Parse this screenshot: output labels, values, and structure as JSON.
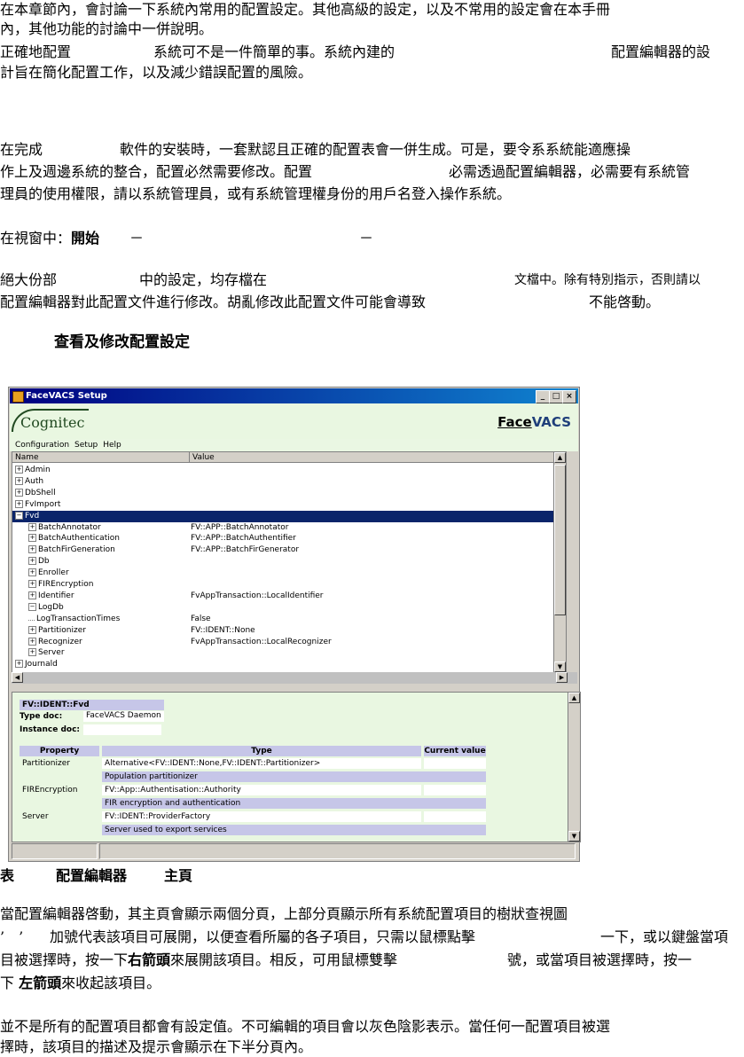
{
  "text": {
    "p1_l1": "在本章節內，會討論一下系統內常用的配置設定。其他高級的設定，以及不常用的設定會在本手冊",
    "p1_l2": "內，其他功能的討論中一併說明。",
    "p2_l1a": "正確地配置",
    "p2_l1b": "系統可不是一件簡單的事。系統內建的",
    "p2_l1c": "配置編輯器的設",
    "p2_l2": "計旨在簡化配置工作，以及減少錯誤配置的風險。",
    "p3_l1a": "在完成",
    "p3_l1b": "軟件的安裝時，一套默認且正確的配置表會一併生成。可是，要令系系統能適應操",
    "p3_l2a": "作上及週邊系統的整合，配置必然需要修改。配置",
    "p3_l2b": "必需透過配置編輯器，必需要有系統管",
    "p3_l3": "理員的使用權限，請以系統管理員，或有系統管理權身份的用戶名登入操作系統。",
    "p4_a": "在視窗中：",
    "p4_b": "開始",
    "p4_c": "－",
    "p4_d": "－",
    "p5_l1a": "絕大份部",
    "p5_l1b": "中的設定，均存檔在",
    "p5_l1c": "文檔中。除有特別指示，否則請以",
    "p5_l2a": "配置編輯器對此配置文件進行修改。胡亂修改此配置文件可能會導致",
    "p5_l2b": "不能啓動。",
    "heading": "查看及修改配置設定",
    "caption_a": "表",
    "caption_b": "配置編輯器",
    "caption_c": "主頁",
    "p6_l1": "當配置編輯器啓動，其主頁會顯示兩個分頁，上部分頁顯示所有系統配置項目的樹狀查視圖",
    "p6_l2a": "’　’",
    "p6_l2b": "加號代表該項目可展開，以便查看所屬的各子項目，只需以鼠標點擊",
    "p6_l2c": "一下，或以鍵盤當項",
    "p6_l3a": "目被選擇時，按一下",
    "p6_l3b": "右箭頭",
    "p6_l3c": "來展開該項目。相反，可用鼠標雙擊",
    "p6_l3d": "號，或當項目被選擇時，按一",
    "p6_l4a": "下",
    "p6_l4b": "左箭頭",
    "p6_l4c": "來收起該項目。",
    "p7_l1": "並不是所有的配置項目都會有設定值。不可編輯的項目會以灰色陰影表示。當任何一配置項目被選",
    "p7_l2": "擇時，該項目的描述及提示會顯示在下半分頁內。"
  },
  "window": {
    "title": "FaceVACS Setup",
    "logo": "Cognitec",
    "brand_face": "Face",
    "brand_vacs": "VACS",
    "menu": [
      "Configuration",
      "Setup",
      "Help"
    ],
    "col_name": "Name",
    "col_value": "Value",
    "tree": [
      {
        "label": "Admin",
        "value": ""
      },
      {
        "label": "Auth",
        "value": ""
      },
      {
        "label": "DbShell",
        "value": ""
      },
      {
        "label": "FvImport",
        "value": ""
      },
      {
        "label": "Fvd",
        "value": ""
      },
      {
        "label": "BatchAnnotator",
        "value": "FV::APP::BatchAnnotator"
      },
      {
        "label": "BatchAuthentication",
        "value": "FV::APP::BatchAuthentifier"
      },
      {
        "label": "BatchFirGeneration",
        "value": "FV::APP::BatchFirGenerator"
      },
      {
        "label": "Db",
        "value": ""
      },
      {
        "label": "Enroller",
        "value": ""
      },
      {
        "label": "FIREncryption",
        "value": ""
      },
      {
        "label": "Identifier",
        "value": "FvAppTransaction::LocalIdentifier"
      },
      {
        "label": "LogDb",
        "value": ""
      },
      {
        "label": "LogTransactionTimes",
        "value": "False"
      },
      {
        "label": "Partitionizer",
        "value": "FV::IDENT::None"
      },
      {
        "label": "Recognizer",
        "value": "FvAppTransaction::LocalRecognizer"
      },
      {
        "label": "Server",
        "value": ""
      },
      {
        "label": "Journald",
        "value": ""
      }
    ],
    "detail_title": "FV::IDENT::Fvd",
    "type_doc_label": "Type doc:",
    "type_doc_value": "FaceVACS Daemon",
    "instance_doc_label": "Instance doc:",
    "prop_col": "Property",
    "type_col": "Type",
    "current_col": "Current value",
    "props": [
      {
        "name": "Partitionizer",
        "type": "Alternative<FV::IDENT::None,FV::IDENT::Partitionizer>",
        "desc": "Population partitionizer"
      },
      {
        "name": "FIREncryption",
        "type": "FV::App::Authentisation::Authority",
        "desc": "FIR encryption and authentication"
      },
      {
        "name": "Server",
        "type": "FV::IDENT::ProviderFactory",
        "desc": "Server used to export services"
      }
    ]
  }
}
